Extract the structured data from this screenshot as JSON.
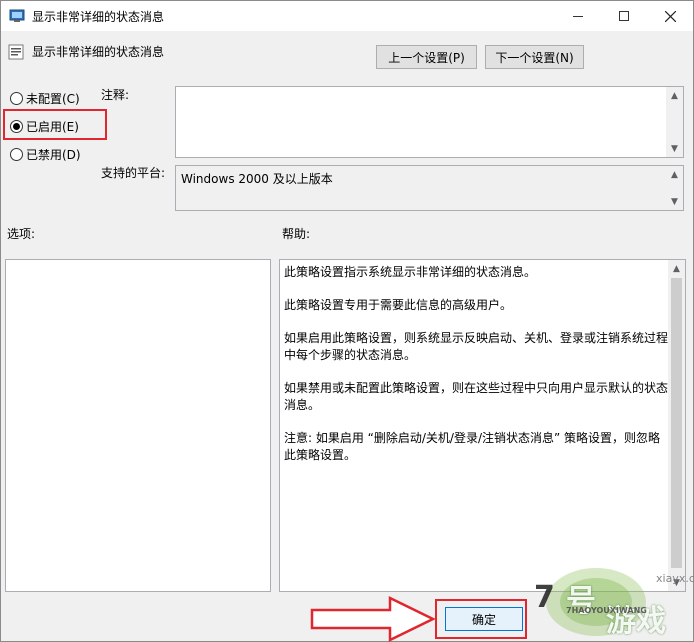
{
  "window": {
    "title": "显示非常详细的状态消息",
    "controls": {
      "minimize": "minimize-icon",
      "maximize": "maximize-icon",
      "close": "close-icon"
    }
  },
  "header": {
    "policy_title": "显示非常详细的状态消息",
    "prev_label": "上一个设置(P)",
    "next_label": "下一个设置(N)"
  },
  "state": {
    "options": [
      {
        "label": "未配置(C)",
        "checked": false
      },
      {
        "label": "已启用(E)",
        "checked": true
      },
      {
        "label": "已禁用(D)",
        "checked": false
      }
    ]
  },
  "comment": {
    "label": "注释:",
    "value": ""
  },
  "platform": {
    "label": "支持的平台:",
    "value": "Windows 2000 及以上版本"
  },
  "options_label": "选项:",
  "help": {
    "label": "帮助:",
    "paragraphs": [
      "此策略设置指示系统显示非常详细的状态消息。",
      "此策略设置专用于需要此信息的高级用户。",
      "如果启用此策略设置，则系统显示反映启动、关机、登录或注销系统过程中每个步骤的状态消息。",
      "如果禁用或未配置此策略设置，则在这些过程中只向用户显示默认的状态消息。",
      "注意: 如果启用 “删除启动/关机/登录/注销状态消息” 策略设置，则忽略此策略设置。"
    ]
  },
  "footer": {
    "ok_label": "确定"
  },
  "watermark": {
    "num": "7",
    "hao": "号",
    "youxi": "游戏",
    "small": "xiayx.com",
    "pinyin": "7HAOYOUXIWANG"
  },
  "colors": {
    "highlight_red": "#e0262e",
    "ok_border": "#0078d7"
  }
}
